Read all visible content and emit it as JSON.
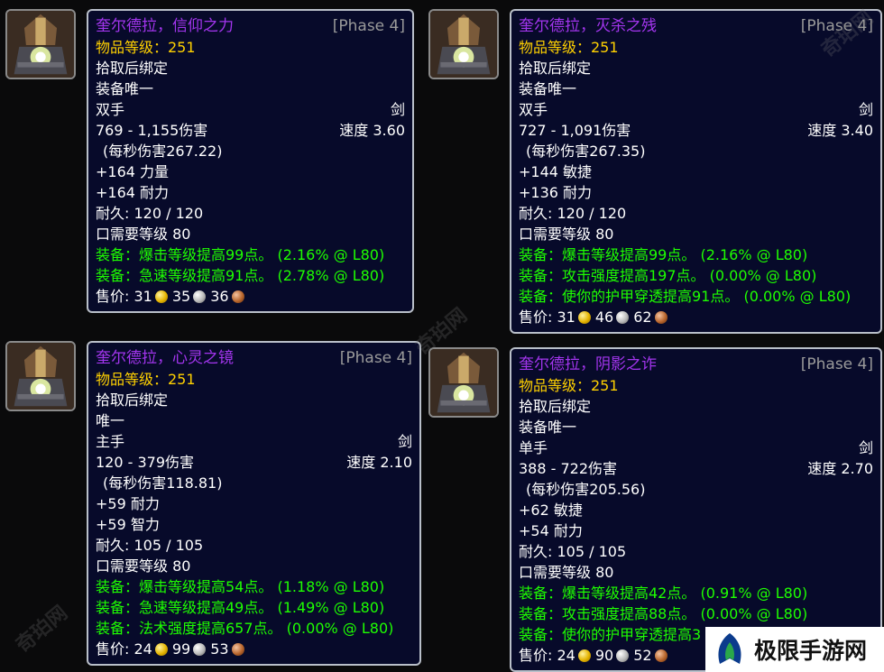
{
  "items": [
    {
      "name": "奎尔德拉，信仰之力",
      "phase": "[Phase 4]",
      "ilvl": "物品等级：251",
      "bind": "拾取后绑定",
      "unique": "装备唯一",
      "slot": "双手",
      "type": "剑",
      "damage": "769 - 1,155伤害",
      "speed": "速度 3.60",
      "dps": "(每秒伤害267.22)",
      "stats": [
        "+164 力量",
        "+164 耐力"
      ],
      "durability": "耐久: 120 / 120",
      "level": "口需要等级 80",
      "equips": [
        "装备：爆击等级提高99点。 (2.16% @ L80)",
        "装备：急速等级提高91点。 (2.78% @ L80)"
      ],
      "sell_label": "售价:",
      "gold": "31",
      "silver": "35",
      "copper": "36"
    },
    {
      "name": "奎尔德拉，灭杀之残",
      "phase": "[Phase 4]",
      "ilvl": "物品等级：251",
      "bind": "拾取后绑定",
      "unique": "装备唯一",
      "slot": "双手",
      "type": "剑",
      "damage": "727 - 1,091伤害",
      "speed": "速度 3.40",
      "dps": "(每秒伤害267.35)",
      "stats": [
        "+144 敏捷",
        "+136 耐力"
      ],
      "durability": "耐久: 120 / 120",
      "level": "口需要等级 80",
      "equips": [
        "装备：爆击等级提高99点。 (2.16% @ L80)",
        "装备：攻击强度提高197点。 (0.00% @ L80)",
        "装备：使你的护甲穿透提高91点。 (0.00% @ L80)"
      ],
      "sell_label": "售价:",
      "gold": "31",
      "silver": "46",
      "copper": "62"
    },
    {
      "name": "奎尔德拉，心灵之镜",
      "phase": "[Phase 4]",
      "ilvl": "物品等级：251",
      "bind": "拾取后绑定",
      "unique": "唯一",
      "slot": "主手",
      "type": "剑",
      "damage": "120 - 379伤害",
      "speed": "速度 2.10",
      "dps": "(每秒伤害118.81)",
      "stats": [
        "+59 耐力",
        "+59 智力"
      ],
      "durability": "耐久: 105 / 105",
      "level": "口需要等级 80",
      "equips": [
        "装备：爆击等级提高54点。 (1.18% @ L80)",
        "装备：急速等级提高49点。 (1.49% @ L80)",
        "装备：法术强度提高657点。 (0.00% @ L80)"
      ],
      "sell_label": "售价:",
      "gold": "24",
      "silver": "99",
      "copper": "53"
    },
    {
      "name": "奎尔德拉，阴影之诈",
      "phase": "[Phase 4]",
      "ilvl": "物品等级：251",
      "bind": "拾取后绑定",
      "unique": "装备唯一",
      "slot": "单手",
      "type": "剑",
      "damage": "388 - 722伤害",
      "speed": "速度 2.70",
      "dps": "(每秒伤害205.56)",
      "stats": [
        "+62 敏捷",
        "+54 耐力"
      ],
      "durability": "耐久: 105 / 105",
      "level": "口需要等级 80",
      "equips": [
        "装备：爆击等级提高42点。 (0.91% @ L80)",
        "装备：攻击强度提高88点。 (0.00% @ L80)",
        "装备：使你的护甲穿透提高3"
      ],
      "sell_label": "售价:",
      "gold": "24",
      "silver": "90",
      "copper": "52"
    }
  ],
  "watermark": "奇珀网",
  "badge_text": "极限手游网",
  "colors": {
    "epic": "#a335ee",
    "ilvl": "#ffd100",
    "equip": "#1eff00",
    "phase": "#9a9a9a",
    "tooltip_bg": "#070a2a"
  }
}
